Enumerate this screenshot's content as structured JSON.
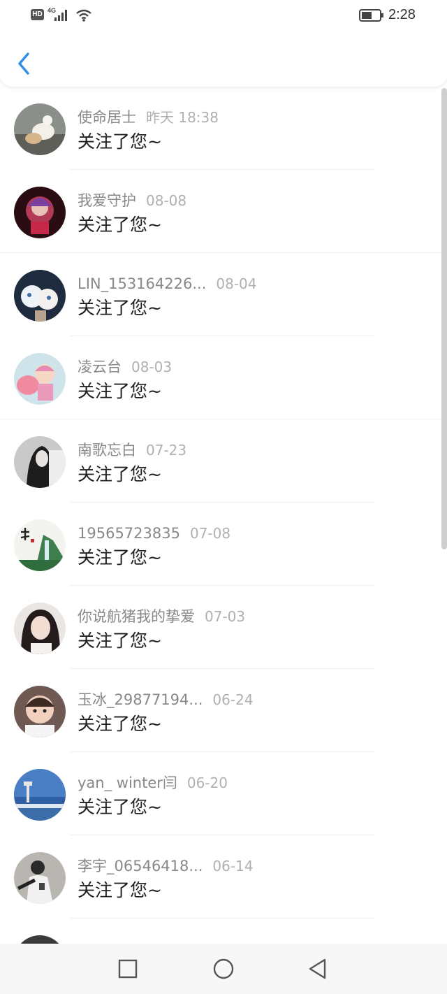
{
  "status_bar": {
    "hd_label": "HD",
    "network_label": "4G",
    "time": "2:28"
  },
  "header": {
    "back_icon": "chevron-left-icon",
    "accent_color": "#2f8fe8"
  },
  "notifications": [
    {
      "name": "使命居士",
      "date": "昨天 18:38",
      "action": "关注了您~"
    },
    {
      "name": "我爱守护",
      "date": "08-08",
      "action": "关注了您~"
    },
    {
      "name": "LIN_153164226...",
      "date": "08-04",
      "action": "关注了您~"
    },
    {
      "name": "凌云台",
      "date": "08-03",
      "action": "关注了您~"
    },
    {
      "name": "南歌忘白",
      "date": "07-23",
      "action": "关注了您~"
    },
    {
      "name": "19565723835",
      "date": "07-08",
      "action": "关注了您~"
    },
    {
      "name": "你说航猪我的挚爱",
      "date": "07-03",
      "action": "关注了您~"
    },
    {
      "name": "玉冰_29877194...",
      "date": "06-24",
      "action": "关注了您~"
    },
    {
      "name": "yan_ winter闫",
      "date": "06-20",
      "action": "关注了您~"
    },
    {
      "name": "李宇_06546418...",
      "date": "06-14",
      "action": "关注了您~"
    }
  ],
  "nav_bar": {
    "icons": [
      "recent-apps-icon",
      "home-icon",
      "back-icon"
    ]
  }
}
